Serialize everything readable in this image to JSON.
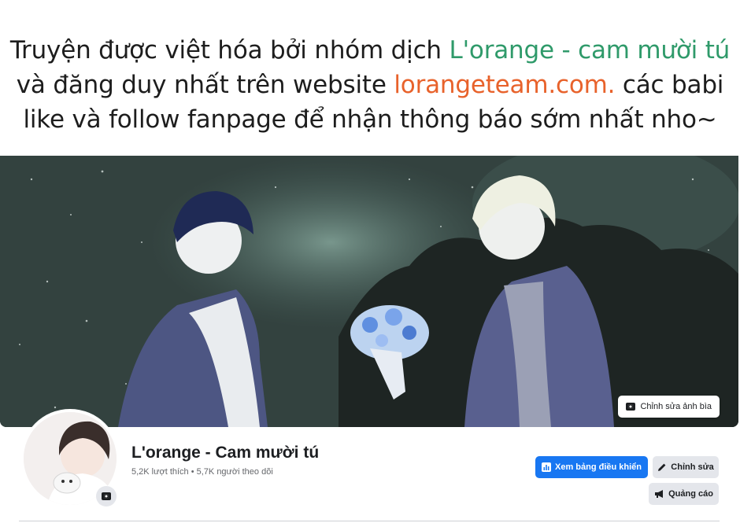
{
  "notice": {
    "line1_prefix": "Truyện được việt hóa bởi nhóm dịch ",
    "line1_group": "L'orange - cam mười tú",
    "line2_prefix": "và đăng duy nhất trên website ",
    "line2_site": "lorangeteam.com.",
    "line2_suffix": " các babi",
    "line3": "like và follow fanpage để nhận thông báo sớm nhất nho~"
  },
  "cover": {
    "edit_cover_label": "Chỉnh sửa ảnh bìa"
  },
  "profile": {
    "page_name": "L'orange - Cam mười tú",
    "stats": "5,2K lượt thích • 5,7K người theo dõi"
  },
  "actions": {
    "dashboard_label": "Xem bảng điều khiển",
    "edit_label": "Chỉnh sửa",
    "ads_label": "Quảng cáo"
  },
  "colors": {
    "brand_blue": "#1877f2",
    "accent_green": "#2f9a6a",
    "accent_orange": "#e8622b"
  }
}
